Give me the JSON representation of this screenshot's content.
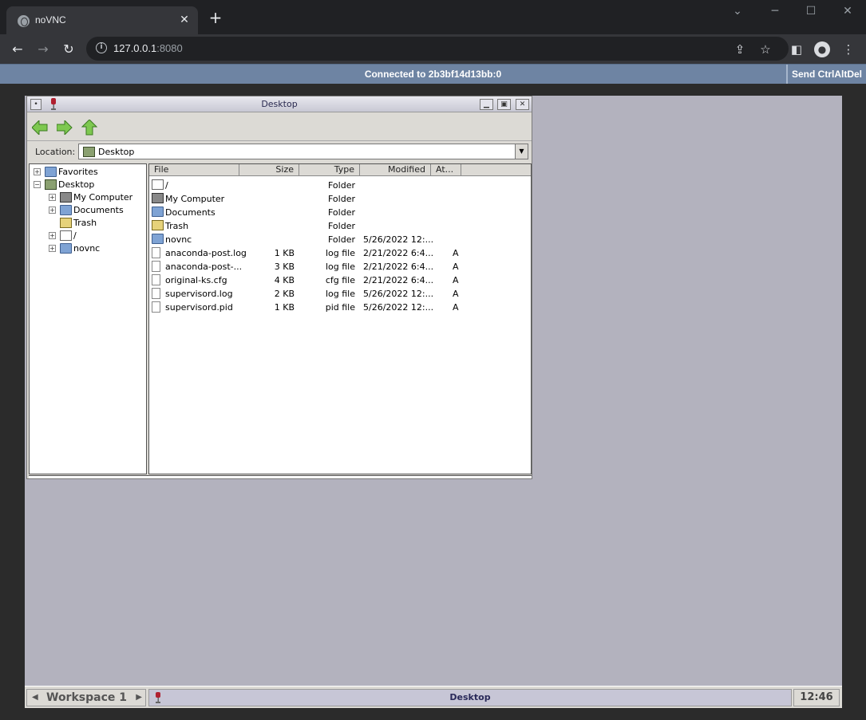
{
  "browser": {
    "tab_title": "noVNC",
    "url_host": "127.0.0.1",
    "url_port": ":8080"
  },
  "vnc": {
    "status": "Connected to 2b3bf14d13bb:0",
    "ctrlaltdel": "Send CtrlAltDel"
  },
  "window": {
    "title": "Desktop",
    "location_label": "Location:",
    "location_value": "Desktop"
  },
  "tree": [
    {
      "label": "Favorites",
      "icon": "folder-icon",
      "toggle": "+"
    },
    {
      "label": "Desktop",
      "icon": "desktop-icon",
      "toggle": "−"
    },
    {
      "label": "My Computer",
      "icon": "computer-icon",
      "toggle": "+"
    },
    {
      "label": "Documents",
      "icon": "documents-icon",
      "toggle": "+"
    },
    {
      "label": "Trash",
      "icon": "trash-icon",
      "toggle": ""
    },
    {
      "label": "/",
      "icon": "drive-icon",
      "toggle": "+"
    },
    {
      "label": "novnc",
      "icon": "folder-icon",
      "toggle": "+"
    }
  ],
  "columns": [
    "File",
    "Size",
    "Type",
    "Modified",
    "At..."
  ],
  "files": [
    {
      "name": "/",
      "size": "",
      "type": "Folder",
      "modified": "",
      "attr": "",
      "icon": "drive-icon"
    },
    {
      "name": "My Computer",
      "size": "",
      "type": "Folder",
      "modified": "",
      "attr": "",
      "icon": "computer-icon"
    },
    {
      "name": "Documents",
      "size": "",
      "type": "Folder",
      "modified": "",
      "attr": "",
      "icon": "documents-icon"
    },
    {
      "name": "Trash",
      "size": "",
      "type": "Folder",
      "modified": "",
      "attr": "",
      "icon": "trash-icon"
    },
    {
      "name": "novnc",
      "size": "",
      "type": "Folder",
      "modified": "5/26/2022 12:...",
      "attr": "",
      "icon": "folder-icon"
    },
    {
      "name": "anaconda-post.log",
      "size": "1 KB",
      "type": "log file",
      "modified": "2/21/2022 6:4...",
      "attr": "A",
      "icon": "file-icon"
    },
    {
      "name": "anaconda-post-...",
      "size": "3 KB",
      "type": "log file",
      "modified": "2/21/2022 6:4...",
      "attr": "A",
      "icon": "file-icon"
    },
    {
      "name": "original-ks.cfg",
      "size": "4 KB",
      "type": "cfg file",
      "modified": "2/21/2022 6:4...",
      "attr": "A",
      "icon": "file-icon"
    },
    {
      "name": "supervisord.log",
      "size": "2 KB",
      "type": "log file",
      "modified": "5/26/2022 12:...",
      "attr": "A",
      "icon": "file-icon"
    },
    {
      "name": "supervisord.pid",
      "size": "1 KB",
      "type": "pid file",
      "modified": "5/26/2022 12:...",
      "attr": "A",
      "icon": "file-icon"
    }
  ],
  "taskbar": {
    "workspace": "Workspace 1",
    "task": "Desktop",
    "clock": "12:46"
  }
}
